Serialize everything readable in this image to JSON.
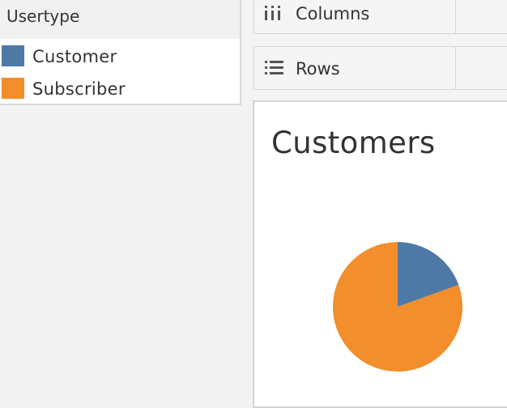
{
  "legend": {
    "title": "Usertype",
    "items": [
      {
        "label": "Customer",
        "color": "#4e79a7"
      },
      {
        "label": "Subscriber",
        "color": "#f28e2b"
      }
    ]
  },
  "shelves": {
    "columns": {
      "label": "Columns",
      "icon": "columns-icon"
    },
    "rows": {
      "label": "Rows",
      "icon": "rows-icon"
    }
  },
  "sheet": {
    "title": "Customers"
  },
  "chart_data": {
    "type": "pie",
    "title": "Customers",
    "categories": [
      "Customer",
      "Subscriber"
    ],
    "values": [
      19.5,
      80.5
    ],
    "unit": "percent (estimated from slice angles)",
    "colors": [
      "#4e79a7",
      "#f28e2b"
    ],
    "start_angle": "12 o'clock",
    "direction": "clockwise"
  }
}
